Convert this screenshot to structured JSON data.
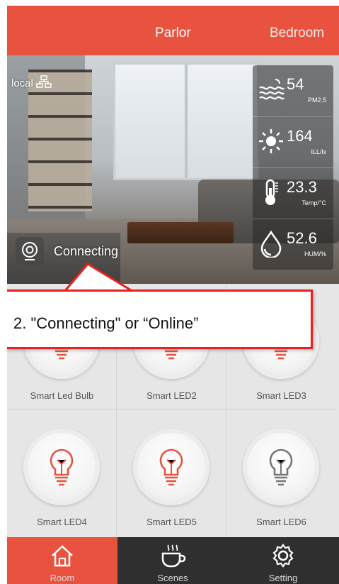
{
  "tabs": {
    "active": "Parlor",
    "next": "Bedroom"
  },
  "room": {
    "mode_label": "local",
    "status": "Connecting",
    "sensors": [
      {
        "icon": "pm25-icon",
        "value": "54",
        "unit": "PM2.5"
      },
      {
        "icon": "sun-icon",
        "value": "164",
        "unit": "ILL/lx"
      },
      {
        "icon": "thermometer-icon",
        "value": "23.3",
        "unit": "Temp/°C"
      },
      {
        "icon": "humidity-icon",
        "value": "52.6",
        "unit": "HUM/%"
      }
    ]
  },
  "callout": {
    "text": "2. \"Connecting\" or “Online”"
  },
  "devices": [
    {
      "label": "Smart Led Bulb",
      "on": true
    },
    {
      "label": "Smart LED2",
      "on": true
    },
    {
      "label": "Smart LED3",
      "on": true
    },
    {
      "label": "Smart LED4",
      "on": true
    },
    {
      "label": "Smart LED5",
      "on": true
    },
    {
      "label": "Smart LED6",
      "on": false
    }
  ],
  "nav": [
    {
      "label": "Room",
      "icon": "home-icon",
      "active": true
    },
    {
      "label": "Scenes",
      "icon": "cup-icon",
      "active": false
    },
    {
      "label": "Setting",
      "icon": "gear-icon",
      "active": false
    }
  ],
  "colors": {
    "accent": "#e8523f",
    "callout_border": "#e8201f",
    "nav_bg": "#2f2f2f",
    "bulb_on": "#e8523f",
    "bulb_off": "#777777"
  }
}
